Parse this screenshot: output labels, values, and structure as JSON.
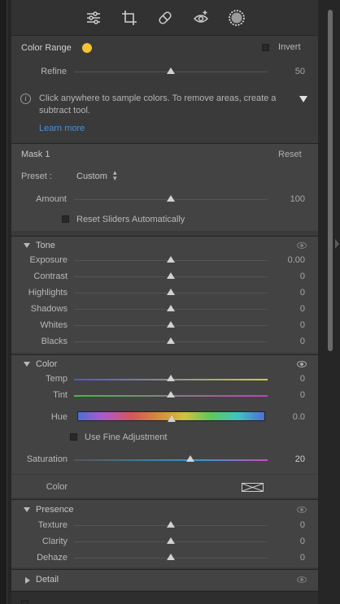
{
  "colors": {
    "swatch": "#f4c430",
    "panel": "#3a3a3a",
    "subpanel": "#434343"
  },
  "toolbar": {
    "icons": [
      "edit-sliders-icon",
      "crop-icon",
      "healing-icon",
      "red-eye-icon",
      "masking-icon"
    ]
  },
  "color_range": {
    "title": "Color Range",
    "invert_label": "Invert",
    "refine": {
      "label": "Refine",
      "value": "50",
      "fraction": 0.5
    },
    "info_text": "Click anywhere to sample colors. To remove areas, create a subtract tool.",
    "learn_more": "Learn more"
  },
  "mask": {
    "name": "Mask 1",
    "reset_label": "Reset",
    "preset_label": "Preset :",
    "preset_value": "Custom",
    "amount": {
      "label": "Amount",
      "value": "100",
      "fraction": 0.5
    },
    "reset_sliders_label": "Reset Sliders Automatically"
  },
  "tone": {
    "title": "Tone",
    "sliders": [
      {
        "label": "Exposure",
        "value": "0.00",
        "fraction": 0.5
      },
      {
        "label": "Contrast",
        "value": "0",
        "fraction": 0.5
      },
      {
        "label": "Highlights",
        "value": "0",
        "fraction": 0.5
      },
      {
        "label": "Shadows",
        "value": "0",
        "fraction": 0.5
      },
      {
        "label": "Whites",
        "value": "0",
        "fraction": 0.5
      },
      {
        "label": "Blacks",
        "value": "0",
        "fraction": 0.5
      }
    ]
  },
  "color": {
    "title": "Color",
    "temp": {
      "label": "Temp",
      "value": "0",
      "fraction": 0.5
    },
    "tint": {
      "label": "Tint",
      "value": "0",
      "fraction": 0.5
    },
    "hue": {
      "label": "Hue",
      "value": "0.0",
      "fraction": 0.5
    },
    "fine_adjust_label": "Use Fine Adjustment",
    "saturation": {
      "label": "Saturation",
      "value": "20",
      "fraction": 0.6
    },
    "color_label": "Color"
  },
  "presence": {
    "title": "Presence",
    "sliders": [
      {
        "label": "Texture",
        "value": "0",
        "fraction": 0.5
      },
      {
        "label": "Clarity",
        "value": "0",
        "fraction": 0.5
      },
      {
        "label": "Dehaze",
        "value": "0",
        "fraction": 0.5
      }
    ]
  },
  "detail": {
    "title": "Detail"
  }
}
